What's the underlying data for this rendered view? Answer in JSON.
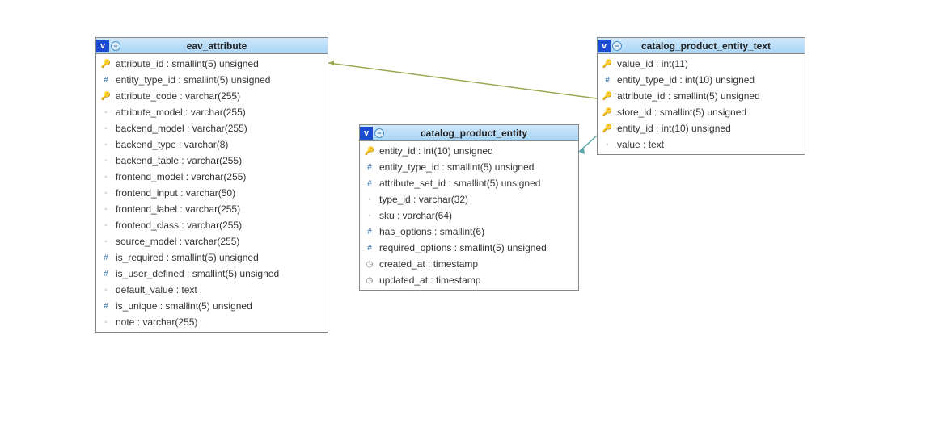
{
  "tables": {
    "eav_attribute": {
      "title": "eav_attribute",
      "columns": [
        {
          "icon": "pk",
          "name": "attribute_id",
          "type": "smallint(5) unsigned"
        },
        {
          "icon": "idx",
          "name": "entity_type_id",
          "type": "smallint(5) unsigned"
        },
        {
          "icon": "pk",
          "name": "attribute_code",
          "type": "varchar(255)"
        },
        {
          "icon": "null",
          "name": "attribute_model",
          "type": "varchar(255)"
        },
        {
          "icon": "null",
          "name": "backend_model",
          "type": "varchar(255)"
        },
        {
          "icon": "null",
          "name": "backend_type",
          "type": "varchar(8)"
        },
        {
          "icon": "null",
          "name": "backend_table",
          "type": "varchar(255)"
        },
        {
          "icon": "null",
          "name": "frontend_model",
          "type": "varchar(255)"
        },
        {
          "icon": "null",
          "name": "frontend_input",
          "type": "varchar(50)"
        },
        {
          "icon": "null",
          "name": "frontend_label",
          "type": "varchar(255)"
        },
        {
          "icon": "null",
          "name": "frontend_class",
          "type": "varchar(255)"
        },
        {
          "icon": "null",
          "name": "source_model",
          "type": "varchar(255)"
        },
        {
          "icon": "idx",
          "name": "is_required",
          "type": "smallint(5) unsigned"
        },
        {
          "icon": "idx",
          "name": "is_user_defined",
          "type": "smallint(5) unsigned"
        },
        {
          "icon": "null",
          "name": "default_value",
          "type": "text"
        },
        {
          "icon": "idx",
          "name": "is_unique",
          "type": "smallint(5) unsigned"
        },
        {
          "icon": "null",
          "name": "note",
          "type": "varchar(255)"
        }
      ]
    },
    "catalog_product_entity": {
      "title": "catalog_product_entity",
      "columns": [
        {
          "icon": "pk",
          "name": "entity_id",
          "type": "int(10) unsigned"
        },
        {
          "icon": "idx",
          "name": "entity_type_id",
          "type": "smallint(5) unsigned"
        },
        {
          "icon": "idx",
          "name": "attribute_set_id",
          "type": "smallint(5) unsigned"
        },
        {
          "icon": "null",
          "name": "type_id",
          "type": "varchar(32)"
        },
        {
          "icon": "null",
          "name": "sku",
          "type": "varchar(64)"
        },
        {
          "icon": "idx",
          "name": "has_options",
          "type": "smallint(6)"
        },
        {
          "icon": "idx",
          "name": "required_options",
          "type": "smallint(5) unsigned"
        },
        {
          "icon": "date",
          "name": "created_at",
          "type": "timestamp"
        },
        {
          "icon": "date",
          "name": "updated_at",
          "type": "timestamp"
        }
      ]
    },
    "catalog_product_entity_text": {
      "title": "catalog_product_entity_text",
      "columns": [
        {
          "icon": "pk",
          "name": "value_id",
          "type": "int(11)"
        },
        {
          "icon": "idx",
          "name": "entity_type_id",
          "type": "int(10) unsigned"
        },
        {
          "icon": "pk",
          "name": "attribute_id",
          "type": "smallint(5) unsigned"
        },
        {
          "icon": "pk",
          "name": "store_id",
          "type": "smallint(5) unsigned"
        },
        {
          "icon": "pk",
          "name": "entity_id",
          "type": "int(10) unsigned"
        },
        {
          "icon": "null",
          "name": "value",
          "type": "text"
        }
      ]
    }
  },
  "connectors": [
    {
      "from_table": "eav_attribute",
      "from_col": "attribute_id",
      "to_table": "catalog_product_entity_text",
      "to_col": "attribute_id",
      "color": "#9aa84f"
    },
    {
      "from_table": "catalog_product_entity",
      "from_col": "entity_id",
      "to_table": "catalog_product_entity_text",
      "to_col": "entity_id",
      "color": "#5aa7a7"
    }
  ],
  "icon_glyphs": {
    "v": "v"
  }
}
